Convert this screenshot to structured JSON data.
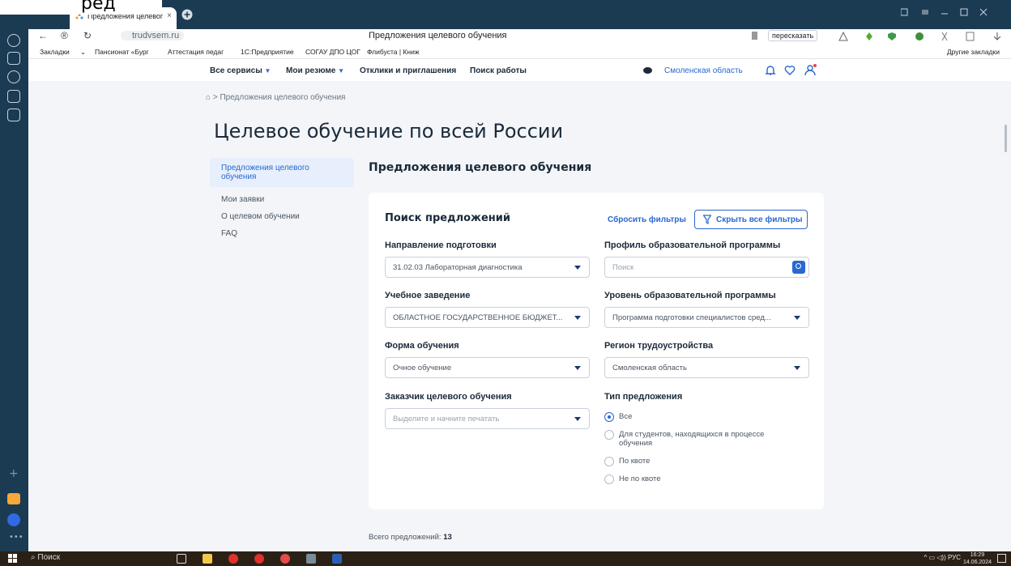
{
  "caption_text": "ред",
  "browser": {
    "tab_title": "Предложения целевог",
    "tab_close": "×",
    "url_domain": "trudvsem.ru",
    "window_title": "Предложения целевого обучения",
    "retell_label": "пересказать",
    "bookmarks": [
      "Закладки",
      "Пансионат «Бург",
      "Аттестация педаг",
      "1С:Предприятие",
      "СОГАУ ДПО ЦОГ",
      "Флибуста | Книж"
    ],
    "other_bookmarks": "Другие закладки"
  },
  "site_nav": {
    "services": "Все сервисы",
    "resumes": "Мои резюме",
    "responses": "Отклики и приглашения",
    "job_search": "Поиск работы",
    "region": "Смоленская область"
  },
  "breadcrumb": "> Предложения целевого обучения",
  "page_title": "Целевое обучение по всей России",
  "left_nav": {
    "items": [
      "Предложения целевого обучения",
      "Мои заявки",
      "О целевом обучении",
      "FAQ"
    ]
  },
  "section_title": "Предложения целевого обучения",
  "search": {
    "title": "Поиск предложений",
    "reset_label": "Сбросить фильтры",
    "hide_all_label": "Скрыть все фильтры",
    "fields": {
      "direction_label": "Направление подготовки",
      "direction_value": "31.02.03 Лабораторная диагностика",
      "profile_label": "Профиль образовательной программы",
      "profile_placeholder": "Поиск",
      "institution_label": "Учебное заведение",
      "institution_value": "ОБЛАСТНОЕ ГОСУДАРСТВЕННОЕ БЮДЖЕТ...",
      "level_label": "Уровень образовательной программы",
      "level_value": "Программа подготовки специалистов сред...",
      "form_label": "Форма обучения",
      "form_value": "Очное обучение",
      "region_label": "Регион трудоустройства",
      "region_value": "Смоленская область",
      "customer_label": "Заказчик целевого обучения",
      "customer_placeholder": "Выделите и начните печатать",
      "type_label": "Тип предложения"
    },
    "offer_types": [
      "Все",
      "Для студентов, находящихся в процессе обучения",
      "По квоте",
      "Не по квоте"
    ],
    "selected_type": "Все"
  },
  "total": {
    "label": "Всего предложений:",
    "value": "13"
  },
  "taskbar": {
    "search": "Поиск",
    "lang": "РУС",
    "time": "16:29",
    "date": "14.06.2024"
  },
  "colors": {
    "accent": "#2a67d0",
    "chrome_dark": "#1b3b53",
    "page_bg": "#f3f5f8"
  }
}
